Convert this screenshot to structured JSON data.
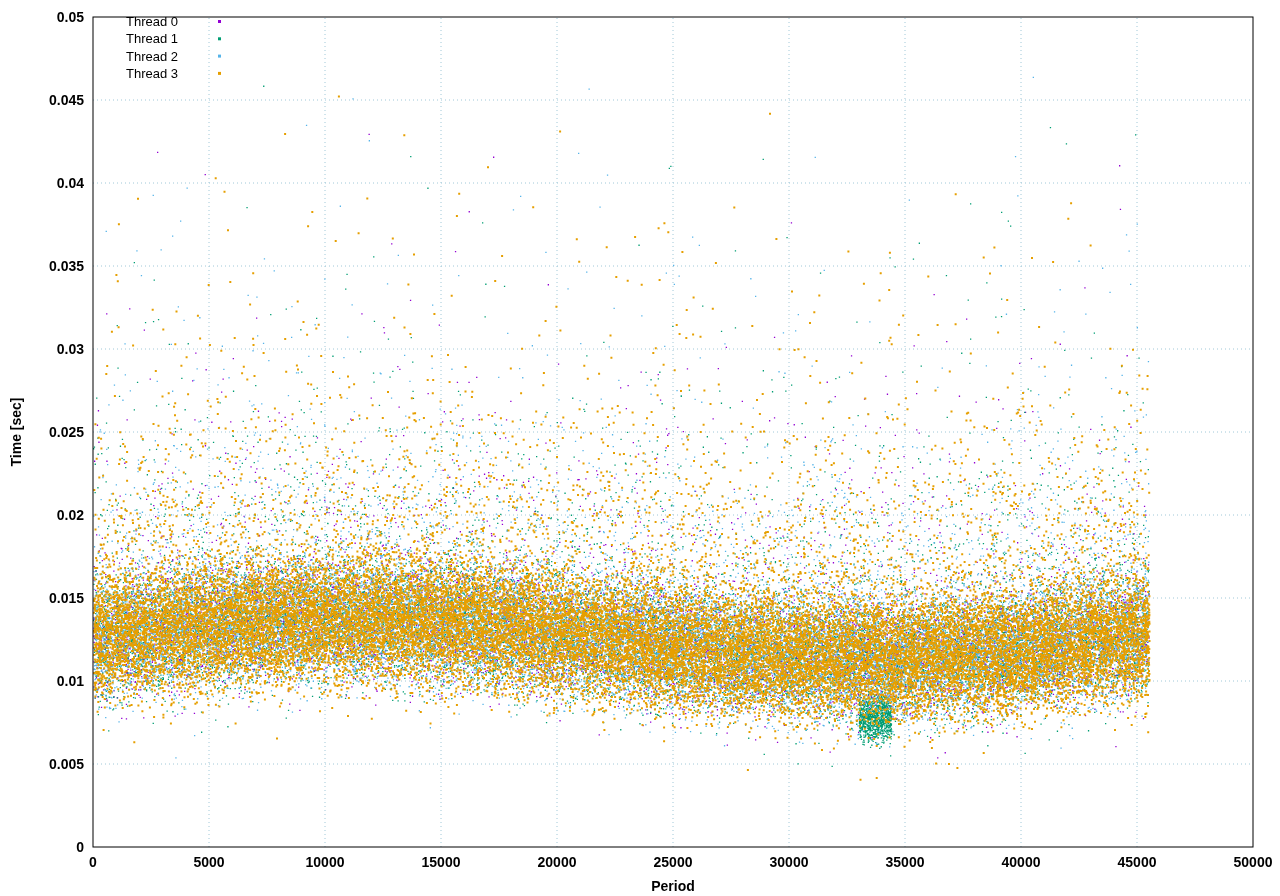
{
  "chart": {
    "ylabel": "Time [sec]",
    "xlabel": "Period",
    "yticks": [
      "0.05",
      "0.045",
      "0.04",
      "0.035",
      "0.03",
      "0.025",
      "0.02",
      "0.015",
      "0.01",
      "0.005",
      "0"
    ],
    "xticks": [
      "0",
      "5000",
      "10000",
      "15000",
      "20000",
      "25000",
      "30000",
      "35000",
      "40000",
      "45000",
      "50000"
    ],
    "legend": [
      {
        "label": "Thread 0",
        "color": "#9400d3"
      },
      {
        "label": "Thread 1",
        "color": "#009e73"
      },
      {
        "label": "Thread 2",
        "color": "#56b4e9"
      },
      {
        "label": "Thread 3",
        "color": "#e69f00"
      }
    ]
  }
}
